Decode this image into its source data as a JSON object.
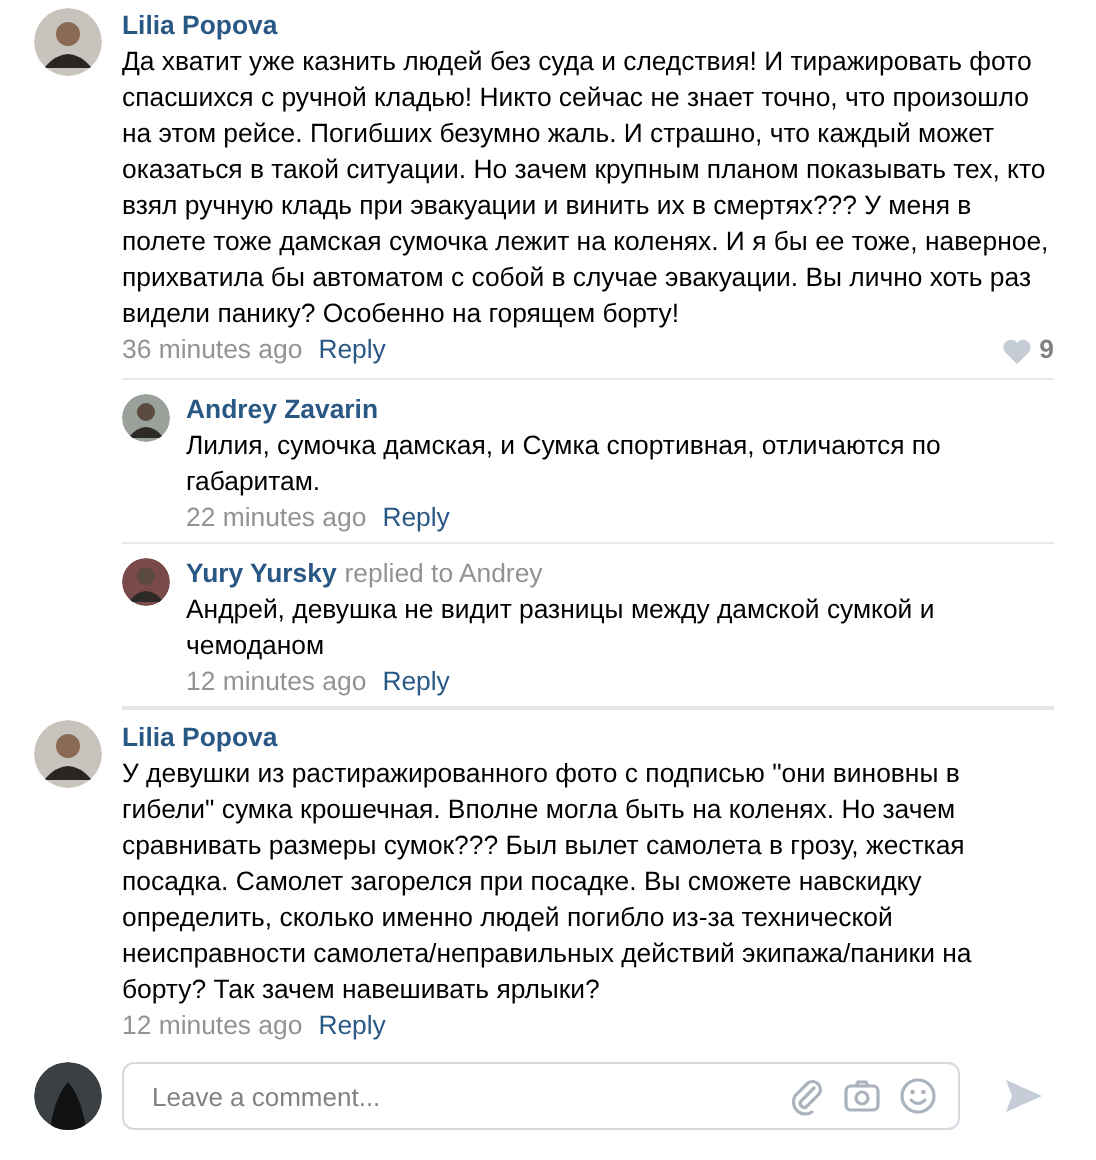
{
  "comments": [
    {
      "author": "Lilia Popova",
      "text": "Да хватит уже казнить людей без суда и следствия! И тиражировать фото спасшихся с ручной кладью! Никто сейчас не знает точно, что произошло на этом рейсе. Погибших безумно жаль. И страшно, что каждый может оказаться в такой ситуации. Но зачем крупным планом показывать тех, кто взял ручную кладь при эвакуации и винить их в смертях??? У меня в полете тоже дамская сумочка лежит на коленях. И я бы ее тоже, наверное, прихватила бы автоматом с собой в случае эвакуации. Вы лично хоть раз видели панику? Особенно на горящем борту!",
      "time": "36 minutes ago",
      "reply": "Reply",
      "likes": "9",
      "children": [
        {
          "author": "Andrey Zavarin",
          "text": "Лилия, сумочка дамская, и Сумка спортивная, отличаются по габаритам.",
          "time": "22 minutes ago",
          "reply": "Reply"
        },
        {
          "author": "Yury Yursky",
          "replied_to": "replied to Andrey",
          "text": "Андрей, девушка не видит разницы между дамской сумкой и чемоданом",
          "time": "12 minutes ago",
          "reply": "Reply"
        }
      ]
    },
    {
      "author": "Lilia Popova",
      "text": "У девушки из растиражированного фото с подписью \"они виновны в гибели\" сумка крошечная. Вполне могла быть на коленях. Но зачем сравнивать размеры сумок??? Был вылет самолета в грозу, жесткая посадка. Самолет загорелся при посадке. Вы сможете навскидку определить, сколько именно людей погибло из-за технической неисправности самолета/неправильных действий экипажа/паники на борту? Так зачем навешивать ярлыки?",
      "time": "12 minutes ago",
      "reply": "Reply"
    }
  ],
  "composer": {
    "placeholder": "Leave a comment..."
  }
}
